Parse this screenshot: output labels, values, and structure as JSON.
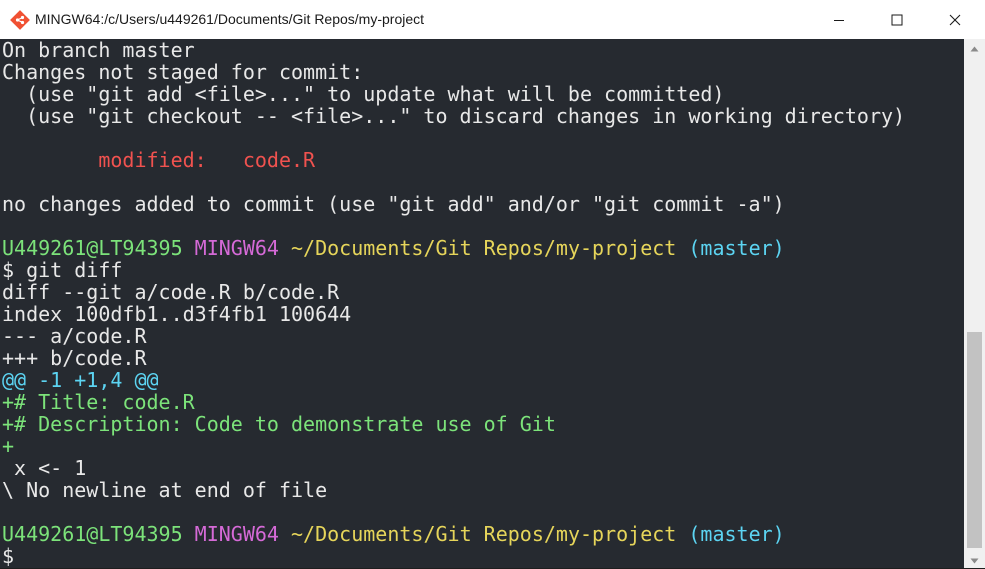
{
  "window": {
    "title": "MINGW64:/c/Users/u449261/Documents/Git Repos/my-project",
    "controls": [
      "minimize",
      "maximize",
      "close"
    ]
  },
  "colors": {
    "background": "#262a30",
    "default_text": "#e8e8e8",
    "modified": "#f0524f",
    "added": "#7ce37a",
    "user_host": "#7ce37a",
    "mingw": "#d56ad7",
    "path": "#e6d55a",
    "branch": "#5cd4f2"
  },
  "terminal": {
    "lines": [
      {
        "text": "On branch master",
        "color": "default"
      },
      {
        "text": "Changes not staged for commit:",
        "color": "default"
      },
      {
        "text": "  (use \"git add <file>...\" to update what will be committed)",
        "color": "default"
      },
      {
        "text": "  (use \"git checkout -- <file>...\" to discard changes in working directory)",
        "color": "default"
      },
      {
        "text": "",
        "color": "default"
      },
      {
        "text": "        modified:   code.R",
        "color": "red"
      },
      {
        "text": "",
        "color": "default"
      },
      {
        "text": "no changes added to commit (use \"git add\" and/or \"git commit -a\")",
        "color": "default"
      },
      {
        "text": "",
        "color": "default"
      },
      {
        "prompt": true,
        "user": "U449261@LT94395",
        "host": "MINGW64",
        "path": "~/Documents/Git Repos/my-project",
        "branch": "(master)"
      },
      {
        "text": "$ git diff",
        "color": "default"
      },
      {
        "text": "diff --git a/code.R b/code.R",
        "color": "default"
      },
      {
        "text": "index 100dfb1..d3f4fb1 100644",
        "color": "default"
      },
      {
        "text": "--- a/code.R",
        "color": "default"
      },
      {
        "text": "+++ b/code.R",
        "color": "default"
      },
      {
        "text": "@@ -1 +1,4 @@",
        "color": "hunk"
      },
      {
        "text": "+# Title: code.R",
        "color": "green"
      },
      {
        "text": "+# Description: Code to demonstrate use of Git",
        "color": "green"
      },
      {
        "text": "+",
        "color": "green"
      },
      {
        "text": " x <- 1",
        "color": "default"
      },
      {
        "text": "\\ No newline at end of file",
        "color": "default"
      },
      {
        "text": "",
        "color": "default"
      },
      {
        "prompt": true,
        "user": "U449261@LT94395",
        "host": "MINGW64",
        "path": "~/Documents/Git Repos/my-project",
        "branch": "(master)"
      },
      {
        "text": "$",
        "color": "default"
      }
    ]
  },
  "icons": {
    "app": "git-bash-icon",
    "minimize": "minimize-icon",
    "maximize": "maximize-icon",
    "close": "close-icon",
    "scroll_up": "scroll-up-arrow-icon",
    "scroll_down": "scroll-down-arrow-icon"
  }
}
